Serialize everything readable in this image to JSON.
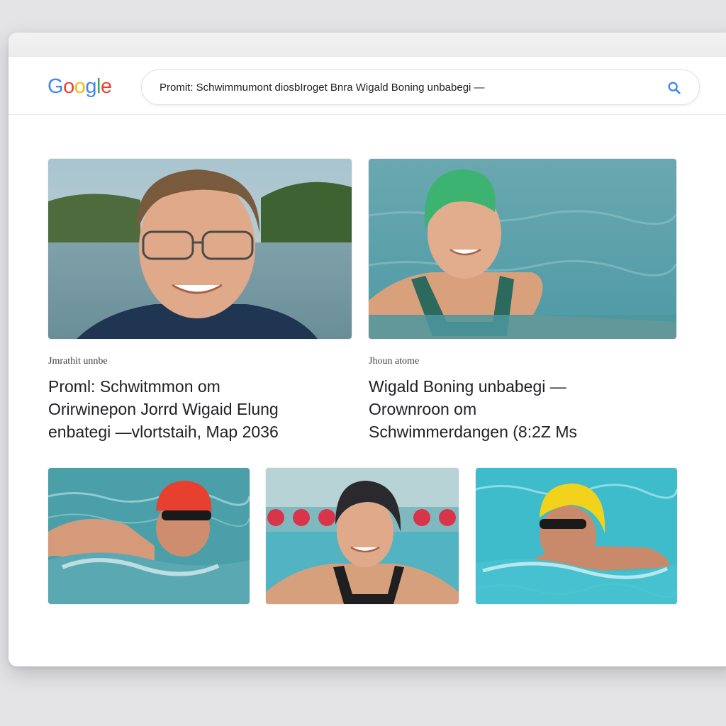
{
  "search": {
    "query": "Promit: Schwimmumont diosbIroget Bnra Wigald Boning unbabegi —"
  },
  "logo": {
    "letters": [
      "G",
      "o",
      "o",
      "g",
      "l",
      "e"
    ],
    "colors": [
      "#4285F4",
      "#EA4335",
      "#FBBC05",
      "#4285F4",
      "#34A853",
      "#EA4335"
    ]
  },
  "results": [
    {
      "source": "Jmrathit unnbe",
      "title_lines": [
        "Proml: Schwitmmon om",
        "Orirwinepon Jorrd Wigaid Elung",
        "enbategi —vlortstaih, Map 2036"
      ]
    },
    {
      "source": "Jhoun atome",
      "title_lines": [
        "Wigald Boning unbabegi —",
        "Orownroon om",
        "Schwimmerdangen (8:2Z Ms"
      ]
    }
  ],
  "colors": {
    "accent": "#4285F4",
    "cap_green": "#3cb371",
    "cap_red": "#e8402e",
    "cap_black": "#2a2a2e",
    "cap_yellow": "#f2d21b",
    "water": "#5ab3c1"
  }
}
